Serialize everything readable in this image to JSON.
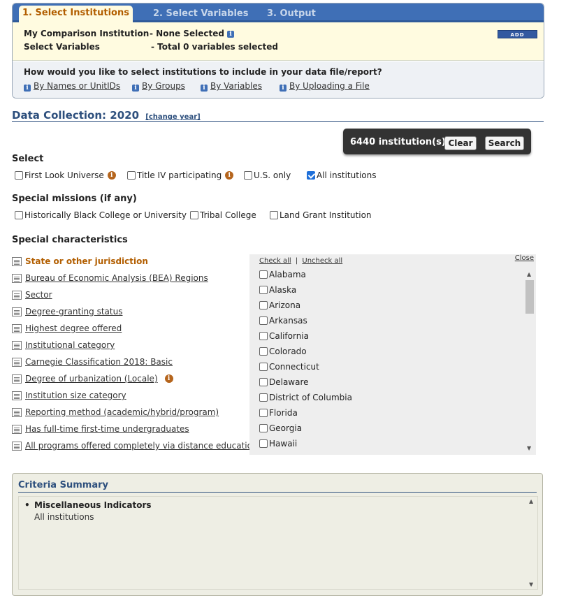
{
  "wizard": {
    "tabs": [
      {
        "label": "1. Select Institutions"
      },
      {
        "label": "2. Select Variables"
      },
      {
        "label": "3. Output"
      }
    ],
    "comparison_label": "My Comparison Institution",
    "comparison_value": "- None Selected",
    "variables_label": "Select Variables",
    "variables_value": "- Total 0 variables selected",
    "add_label": "ADD",
    "how_question": "How would you like to select institutions to include in your data file/report?",
    "how_links": [
      {
        "label": "By Names or UnitIDs"
      },
      {
        "label": "By Groups"
      },
      {
        "label": "By Variables"
      },
      {
        "label": "By Uploading a File"
      }
    ]
  },
  "data_collection": {
    "title": "Data Collection: 2020",
    "change_label": "[change year]"
  },
  "countbar": {
    "count_text": "6440 institution(s)",
    "clear_label": "Clear",
    "search_label": "Search"
  },
  "select_section": {
    "title": "Select",
    "options": [
      {
        "label": "First Look Universe",
        "checked": false
      },
      {
        "label": "Title IV participating",
        "checked": false
      },
      {
        "label": "U.S. only",
        "checked": false
      },
      {
        "label": "All institutions",
        "checked": true
      }
    ]
  },
  "missions_section": {
    "title": "Special missions (if any)",
    "options": [
      {
        "label": "Historically Black College or University",
        "checked": false
      },
      {
        "label": "Tribal College",
        "checked": false
      },
      {
        "label": "Land Grant Institution",
        "checked": false
      }
    ]
  },
  "characteristics": {
    "title": "Special characteristics",
    "items": [
      {
        "label": "State or other jurisdiction",
        "active": true
      },
      {
        "label": "Bureau of Economic Analysis (BEA) Regions"
      },
      {
        "label": "Sector"
      },
      {
        "label": "Degree-granting status"
      },
      {
        "label": "Highest degree offered"
      },
      {
        "label": "Institutional category"
      },
      {
        "label": "Carnegie Classification 2018: Basic"
      },
      {
        "label": "Degree of urbanization (Locale)"
      },
      {
        "label": "Institution size category"
      },
      {
        "label": "Reporting method (academic/hybrid/program)"
      },
      {
        "label": "Has full-time first-time undergraduates"
      },
      {
        "label": "All programs offered completely via distance education"
      }
    ]
  },
  "state_panel": {
    "check_all": "Check all",
    "separator": "|",
    "uncheck_all": "Uncheck all",
    "close": "Close",
    "states": [
      {
        "label": "Alabama",
        "checked": false
      },
      {
        "label": "Alaska",
        "checked": false
      },
      {
        "label": "Arizona",
        "checked": false
      },
      {
        "label": "Arkansas",
        "checked": false
      },
      {
        "label": "California",
        "checked": false
      },
      {
        "label": "Colorado",
        "checked": false
      },
      {
        "label": "Connecticut",
        "checked": false
      },
      {
        "label": "Delaware",
        "checked": false
      },
      {
        "label": "District of Columbia",
        "checked": false
      },
      {
        "label": "Florida",
        "checked": false
      },
      {
        "label": "Georgia",
        "checked": false
      },
      {
        "label": "Hawaii",
        "checked": false
      }
    ]
  },
  "criteria": {
    "title": "Criteria Summary",
    "item": "Miscellaneous Indicators",
    "value": "All institutions"
  },
  "colors": {
    "tab_bar": "#3f6fb6",
    "active_tab_text": "#b25e00",
    "heading_blue": "#2d4f7d",
    "info_bg": "#fffbe0"
  }
}
